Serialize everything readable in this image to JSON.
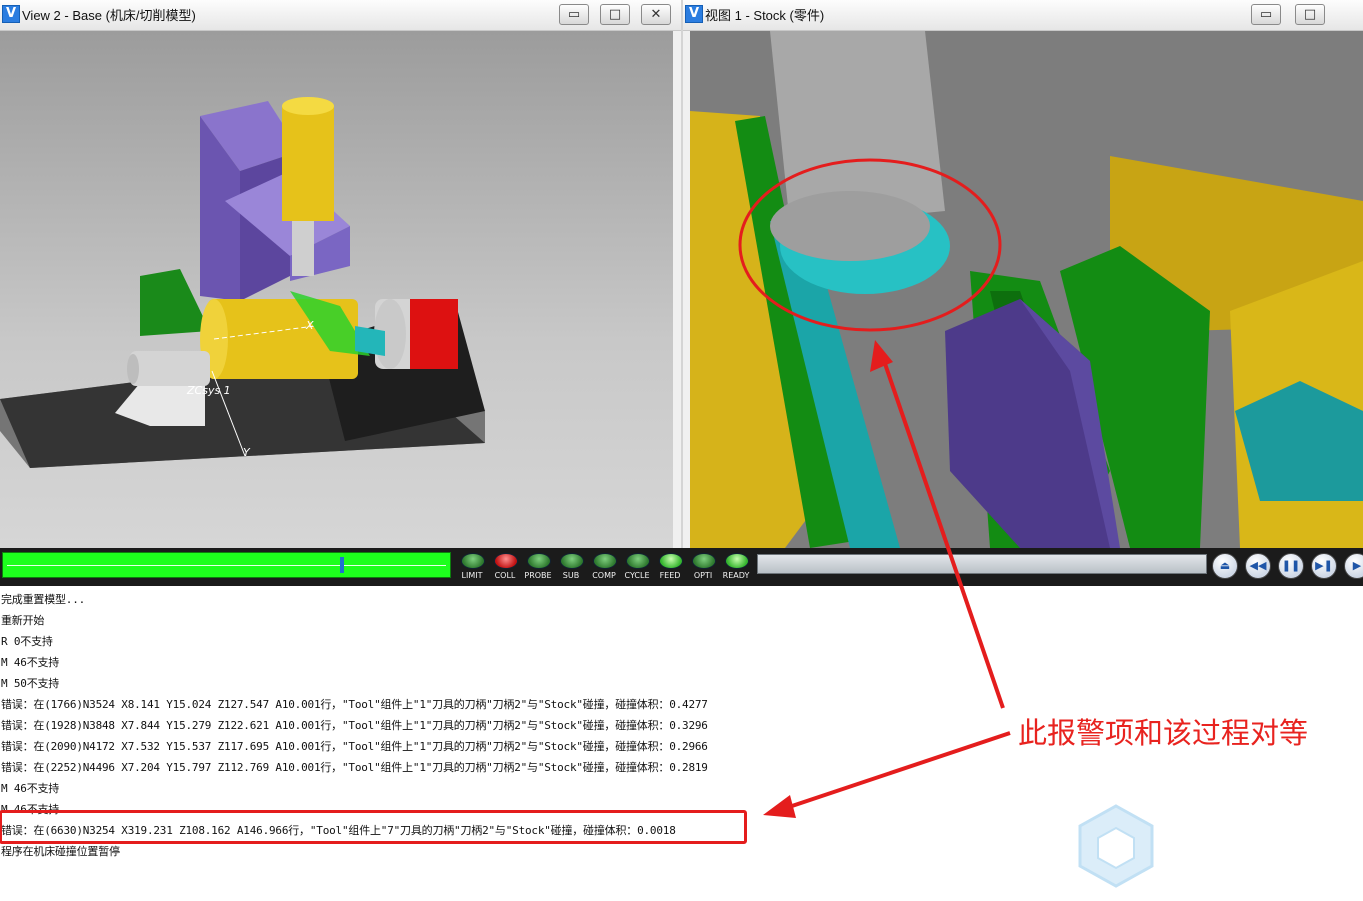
{
  "left_window": {
    "title": "View 2 - Base (机床/切削模型)",
    "minimize_symbol": "▭",
    "maximize_symbol": "□",
    "close_symbol": "✕",
    "axis_label_x": "X",
    "axis_label_y": "Y",
    "csys_label": "ZCsys 1"
  },
  "right_window": {
    "title": "视图 1 - Stock (零件)",
    "minimize_symbol": "▭",
    "maximize_symbol": "□"
  },
  "app_icon_glyph": "V",
  "progress": {
    "fraction": 0.76
  },
  "indicators": [
    {
      "label": "LIMIT",
      "state": "green"
    },
    {
      "label": "COLL",
      "state": "red"
    },
    {
      "label": "PROBE",
      "state": "green"
    },
    {
      "label": "SUB",
      "state": "green"
    },
    {
      "label": "COMP",
      "state": "green"
    },
    {
      "label": "CYCLE",
      "state": "green"
    },
    {
      "label": "FEED",
      "state": "bright"
    },
    {
      "label": "OPTI",
      "state": "green"
    },
    {
      "label": "READY",
      "state": "bright"
    }
  ],
  "playback": [
    {
      "name": "rewind-icon",
      "glyph": "⏏"
    },
    {
      "name": "step-back-icon",
      "glyph": "◀◀"
    },
    {
      "name": "pause-icon",
      "glyph": "❚❚"
    },
    {
      "name": "step-forward-icon",
      "glyph": "▶❚"
    },
    {
      "name": "play-icon",
      "glyph": "▶"
    }
  ],
  "log": [
    "完成重置模型...",
    "重新开始",
    "R 0不支持",
    "M 46不支持",
    "M 50不支持",
    "错误：在(1766)N3524 X8.141 Y15.024 Z127.547 A10.001行，\"Tool\"组件上\"1\"刀具的刀柄\"刀柄2\"与\"Stock\"碰撞，碰撞体积：0.4277",
    "错误：在(1928)N3848 X7.844 Y15.279 Z122.621 A10.001行，\"Tool\"组件上\"1\"刀具的刀柄\"刀柄2\"与\"Stock\"碰撞，碰撞体积：0.3296",
    "错误：在(2090)N4172 X7.532 Y15.537 Z117.695 A10.001行，\"Tool\"组件上\"1\"刀具的刀柄\"刀柄2\"与\"Stock\"碰撞，碰撞体积：0.2966",
    "错误：在(2252)N4496 X7.204 Y15.797 Z112.769 A10.001行，\"Tool\"组件上\"1\"刀具的刀柄\"刀柄2\"与\"Stock\"碰撞，碰撞体积：0.2819",
    "M 46不支持",
    "M 46不支持",
    "错误：在(6630)N3254 X319.231 Z108.162 A146.966行，\"Tool\"组件上\"7\"刀具的刀柄\"刀柄2\"与\"Stock\"碰撞，碰撞体积：0.0018",
    "程序在机床碰撞位置暂停"
  ],
  "annotation": "此报警项和该过程对等",
  "colors": {
    "annotation_red": "#e8231f",
    "progress_green": "#1dff1d",
    "machine_purple": "#6b55b0",
    "part_yellow": "#e6c21a",
    "tool_cyan": "#23b6b9"
  }
}
